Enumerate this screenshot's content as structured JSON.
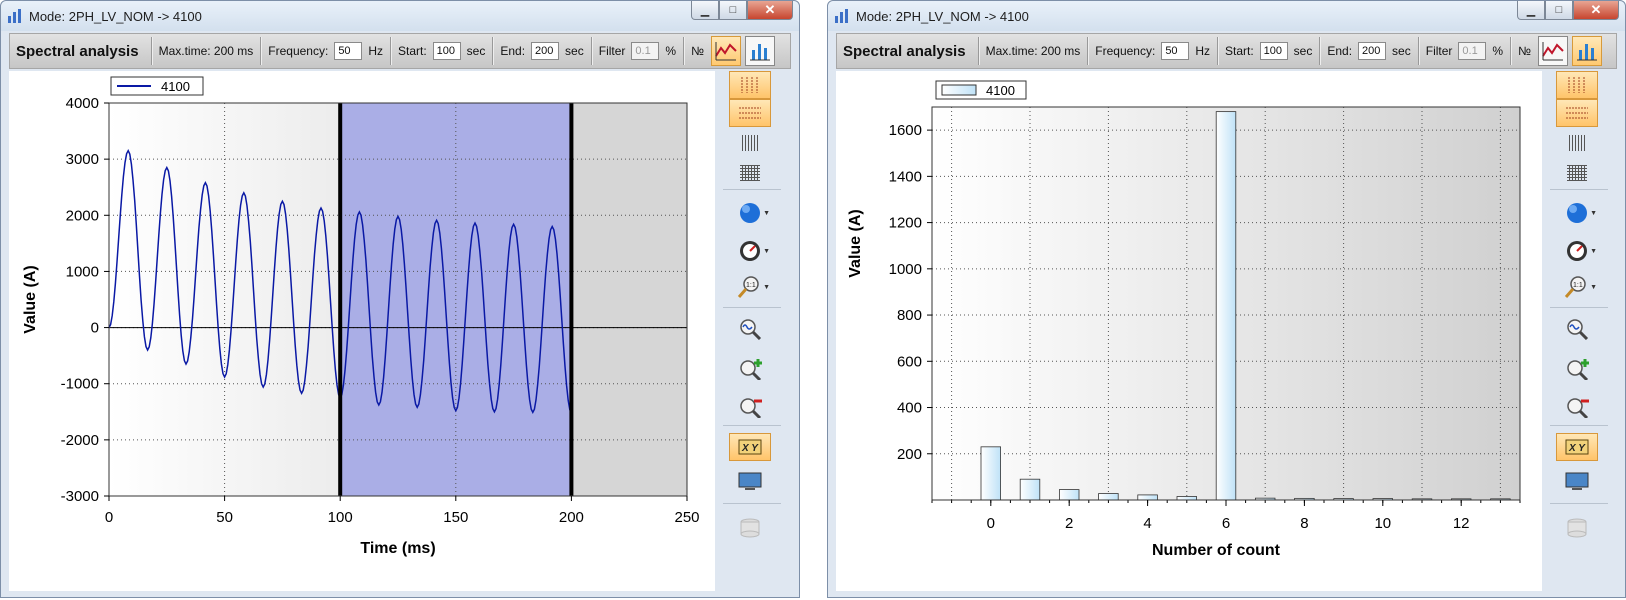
{
  "windows": [
    {
      "title": "Mode: 2PH_LV_NOM -> 4100",
      "toolbar": {
        "title": "Spectral analysis",
        "max_time": "Max.time: 200 ms",
        "frequency_label": "Frequency:",
        "frequency_value": "50",
        "frequency_unit": "Hz",
        "start_label": "Start:",
        "start_value": "100",
        "start_unit": "sec",
        "end_label": "End:",
        "end_value": "200",
        "end_unit": "sec",
        "filter_label": "Filter",
        "filter_value": "0.1",
        "filter_unit": "%",
        "number_label": "№"
      },
      "legend": "4100"
    },
    {
      "title": "Mode: 2PH_LV_NOM -> 4100",
      "toolbar": {
        "title": "Spectral analysis",
        "max_time": "Max.time: 200 ms",
        "frequency_label": "Frequency:",
        "frequency_value": "50",
        "frequency_unit": "Hz",
        "start_label": "Start:",
        "start_value": "100",
        "start_unit": "sec",
        "end_label": "End:",
        "end_value": "200",
        "end_unit": "sec",
        "filter_label": "Filter",
        "filter_value": "0.1",
        "filter_unit": "%",
        "number_label": "№"
      },
      "legend": "4100"
    }
  ],
  "colors": {
    "series_line": "#0a19a5",
    "selection_fill": "#aaaee6",
    "bar_fill": "#bfe2f7",
    "toolbar_active": "#ffc970"
  },
  "sidebar_icons": [
    "vertical-grid-icon",
    "horizontal-grid-icon",
    "fine-vertical-grid-icon",
    "fine-grid-icon",
    "color-sphere-icon",
    "gauge-icon",
    "zoom-1-1-icon",
    "zoom-wave-icon",
    "zoom-in-icon",
    "zoom-out-icon",
    "xy-icon",
    "monitor-icon",
    "database-icon"
  ],
  "chart_data": [
    {
      "type": "line",
      "xlabel": "Time (ms)",
      "ylabel": "Value (A)",
      "xlim": [
        0,
        250
      ],
      "ylim": [
        -3000,
        4000
      ],
      "xticks": [
        "0",
        "50",
        "100",
        "150",
        "200",
        "250"
      ],
      "yticks": [
        "-3000",
        "-2000",
        "-1000",
        "0",
        "1000",
        "2000",
        "3000",
        "4000"
      ],
      "grid": true,
      "legend_position": "top-left",
      "selection": [
        100,
        200
      ],
      "series": [
        {
          "name": "4100",
          "x": [
            0,
            8.3,
            16.7,
            25,
            33.3,
            41.7,
            50,
            58.3,
            66.7,
            75,
            83.3,
            91.7,
            100,
            108.3,
            116.7,
            125,
            133.3,
            141.7,
            150,
            158.3,
            166.7,
            175,
            183.3,
            191.7,
            200
          ],
          "y": [
            0,
            3150,
            -400,
            2850,
            -650,
            2580,
            -880,
            2400,
            -1060,
            2250,
            -1170,
            2130,
            -1250,
            2060,
            -1380,
            1980,
            -1420,
            1910,
            -1480,
            1860,
            -1500,
            1840,
            -1510,
            1800,
            -1520
          ]
        }
      ]
    },
    {
      "type": "bar",
      "xlabel": "Number of count",
      "ylabel": "Value (A)",
      "xlim": [
        -1.5,
        13.5
      ],
      "ylim": [
        0,
        1700
      ],
      "xticks": [
        "0",
        "2",
        "4",
        "6",
        "8",
        "10",
        "12"
      ],
      "yticks": [
        "200",
        "400",
        "600",
        "800",
        "1000",
        "1200",
        "1400",
        "1600"
      ],
      "grid": true,
      "legend_position": "top-left",
      "series": [
        {
          "name": "4100",
          "x": [
            0,
            1,
            2,
            3,
            4,
            5,
            6,
            7,
            8,
            9,
            10,
            11,
            12,
            13
          ],
          "values": [
            230,
            90,
            45,
            28,
            22,
            15,
            1680,
            8,
            7,
            6,
            6,
            5,
            5,
            5
          ]
        }
      ]
    }
  ]
}
